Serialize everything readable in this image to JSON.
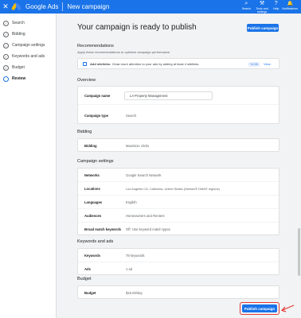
{
  "topbar": {
    "close_icon": "close-icon",
    "brand": "Google Ads",
    "page_title": "New campaign",
    "tools": [
      {
        "label": "Search",
        "icon": "search-icon",
        "glyph": "⌕"
      },
      {
        "label": "Tools and settings",
        "icon": "wrench-icon",
        "glyph": "⚒"
      },
      {
        "label": "Help",
        "icon": "help-icon",
        "glyph": "?"
      },
      {
        "label": "Notifications",
        "icon": "bell-icon",
        "glyph": "🔔"
      }
    ]
  },
  "sidebar": {
    "items": [
      {
        "label": "Search",
        "icon": "check-icon",
        "glyph": "✓"
      },
      {
        "label": "Bidding",
        "icon": "check-icon",
        "glyph": "✓"
      },
      {
        "label": "Campaign settings",
        "icon": "check-icon",
        "glyph": "✓"
      },
      {
        "label": "Keywords and ads",
        "icon": "check-icon",
        "glyph": "✓"
      },
      {
        "label": "Budget",
        "icon": "check-icon",
        "glyph": "✓"
      },
      {
        "label": "Review",
        "icon": "circle-icon",
        "glyph": ""
      }
    ]
  },
  "main": {
    "title": "Your campaign is ready to publish",
    "publish_label": "Publish campaign",
    "recommendations": {
      "title": "Recommendations",
      "subtitle": "Apply these recommendations to optimize campaign performance",
      "item_bold": "Add sitelinks:",
      "item_text": "Draw more attention to your ads by adding at least 4 sitelinks.",
      "chip": "+4.1%",
      "view": "View"
    },
    "overview": {
      "title": "Overview",
      "name_label": "Campaign name",
      "name_value": "LA Property Management",
      "type_label": "Campaign type",
      "type_value": "Search"
    },
    "bidding": {
      "title": "Bidding",
      "label": "Bidding",
      "value": "Maximize clicks"
    },
    "campaign_settings": {
      "title": "Campaign settings",
      "rows": [
        {
          "label": "Networks",
          "value": "Google Search Network"
        },
        {
          "label": "Locations",
          "value": "Los Angeles CA, California, United States (Nielsen® DMA® regions)"
        },
        {
          "label": "Languages",
          "value": "English"
        },
        {
          "label": "Audiences",
          "value": "Homeowners and Renters"
        },
        {
          "label": "Broad match keywords",
          "value": "Off: Use keyword match types"
        }
      ]
    },
    "keywords_ads": {
      "title": "Keywords and ads",
      "rows": [
        {
          "label": "Keywords",
          "value": "78 keywords"
        },
        {
          "label": "Ads",
          "value": "1 ad"
        }
      ]
    },
    "budget": {
      "title": "Budget",
      "label": "Budget",
      "value": "$15.00/day"
    }
  },
  "colors": {
    "primary": "#1a73e8",
    "highlight": "#e53935"
  }
}
